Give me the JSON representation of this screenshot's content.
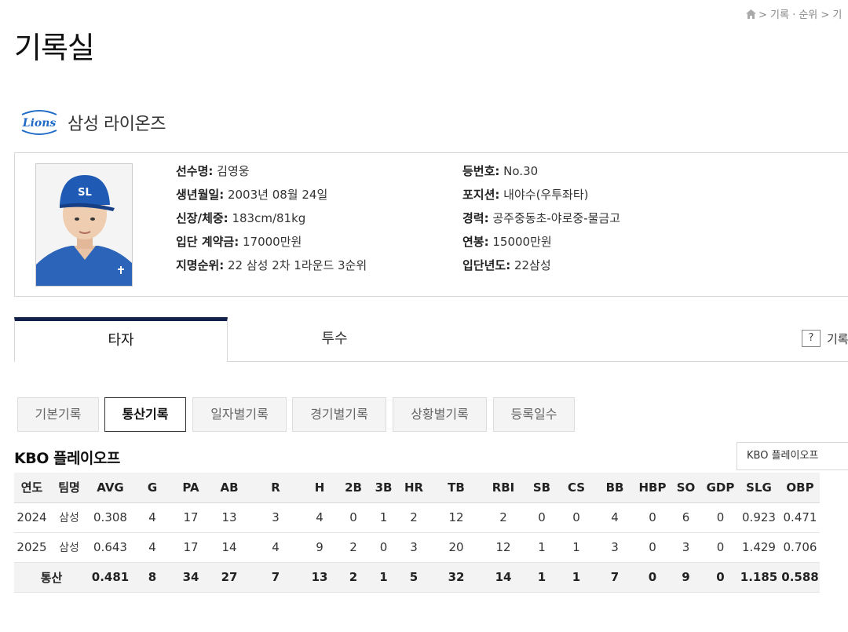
{
  "breadcrumb": {
    "text": "> 기록 · 순위 > 기"
  },
  "page_title": "기록실",
  "team": {
    "name": "삼성 라이온즈",
    "logo_text": "Lions"
  },
  "player": {
    "left": [
      {
        "label": "선수명:",
        "value": " 김영웅"
      },
      {
        "label": "생년월일:",
        "value": " 2003년 08월 24일"
      },
      {
        "label": "신장/체중:",
        "value": " 183cm/81kg"
      },
      {
        "label": "입단 계약금:",
        "value": " 17000만원"
      },
      {
        "label": "지명순위:",
        "value": " 22 삼성 2차 1라운드 3순위"
      }
    ],
    "right": [
      {
        "label": "등번호:",
        "value": " No.30"
      },
      {
        "label": "포지션:",
        "value": " 내야수(우투좌타)"
      },
      {
        "label": "경력:",
        "value": " 공주중동초-야로중-물금고"
      },
      {
        "label": "연봉:",
        "value": " 15000만원"
      },
      {
        "label": "입단년도:",
        "value": " 22삼성"
      }
    ]
  },
  "tabs": {
    "batter": "타자",
    "pitcher": "투수",
    "help_icon": "?",
    "help_label": "기록"
  },
  "subtabs": [
    "기본기록",
    "통산기록",
    "일자별기록",
    "경기별기록",
    "상황별기록",
    "등록일수"
  ],
  "active_subtab": "통산기록",
  "section": {
    "title": "KBO 플레이오프",
    "select_value": "KBO 플레이오프"
  },
  "table": {
    "headers": [
      "연도",
      "팀명",
      "AVG",
      "G",
      "PA",
      "AB",
      "R",
      "H",
      "2B",
      "3B",
      "HR",
      "TB",
      "RBI",
      "SB",
      "CS",
      "BB",
      "HBP",
      "SO",
      "GDP",
      "SLG",
      "OBP"
    ],
    "rows": [
      [
        "2024",
        "삼성",
        "0.308",
        "4",
        "17",
        "13",
        "3",
        "4",
        "0",
        "1",
        "2",
        "12",
        "2",
        "0",
        "0",
        "4",
        "0",
        "6",
        "0",
        "0.923",
        "0.471"
      ],
      [
        "2025",
        "삼성",
        "0.643",
        "4",
        "17",
        "14",
        "4",
        "9",
        "2",
        "0",
        "3",
        "20",
        "12",
        "1",
        "1",
        "3",
        "0",
        "3",
        "0",
        "1.429",
        "0.706"
      ]
    ],
    "total": [
      "통산",
      "0.481",
      "8",
      "34",
      "27",
      "7",
      "13",
      "2",
      "1",
      "5",
      "32",
      "14",
      "1",
      "1",
      "7",
      "0",
      "9",
      "0",
      "1.185",
      "0.588"
    ]
  },
  "colors": {
    "tab_accent": "#13204a",
    "team_blue": "#1f6bc6"
  }
}
